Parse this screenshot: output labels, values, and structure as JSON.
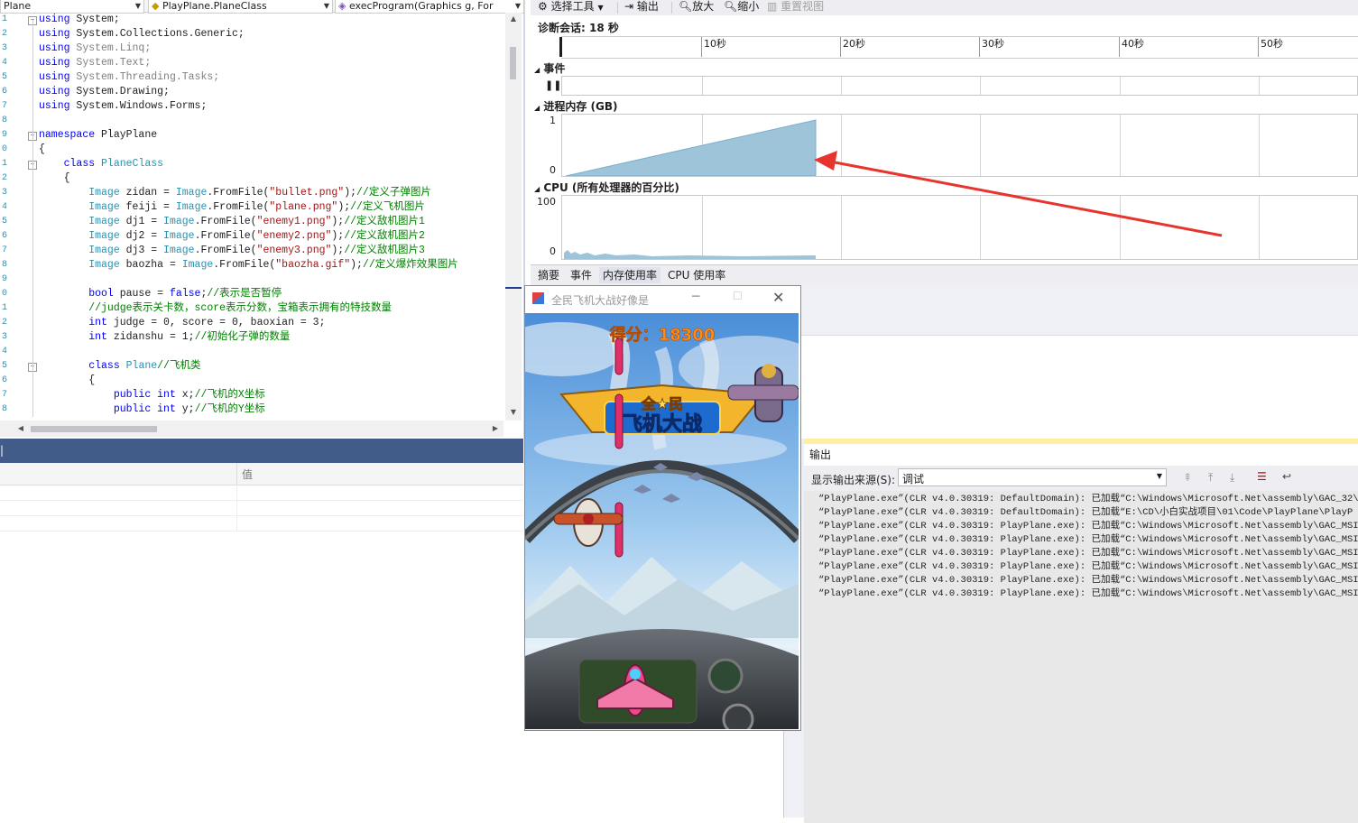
{
  "editor": {
    "nav": [
      "Plane",
      "PlayPlane.PlaneClass",
      "execProgram(Graphics g, For"
    ],
    "line_numbers": [
      "1",
      "2",
      "3",
      "4",
      "5",
      "6",
      "7",
      "8",
      "9",
      "0",
      "1",
      "2",
      "3",
      "4",
      "5",
      "6",
      "7",
      "8",
      "9",
      "0",
      "1",
      "2",
      "3",
      "4",
      "5",
      "6",
      "7",
      "8"
    ],
    "lines": [
      [
        [
          "kw",
          "using "
        ],
        [
          "",
          "System;"
        ]
      ],
      [
        [
          "kw",
          "using "
        ],
        [
          "",
          "System.Collections.Generic;"
        ]
      ],
      [
        [
          "kw",
          "using "
        ],
        [
          "gr",
          "System.Linq;"
        ]
      ],
      [
        [
          "kw",
          "using "
        ],
        [
          "gr",
          "System.Text;"
        ]
      ],
      [
        [
          "kw",
          "using "
        ],
        [
          "gr",
          "System.Threading.Tasks;"
        ]
      ],
      [
        [
          "kw",
          "using "
        ],
        [
          "",
          "System.Drawing;"
        ]
      ],
      [
        [
          "kw",
          "using "
        ],
        [
          "",
          "System.Windows.Forms;"
        ]
      ],
      [],
      [
        [
          "kw",
          "namespace "
        ],
        [
          "",
          "PlayPlane"
        ]
      ],
      [
        [
          "",
          "{"
        ]
      ],
      [
        [
          "",
          "    "
        ],
        [
          "kw",
          "class "
        ],
        [
          "ty",
          "PlaneClass"
        ]
      ],
      [
        [
          "",
          "    {"
        ]
      ],
      [
        [
          "",
          "        "
        ],
        [
          "ty",
          "Image"
        ],
        [
          "",
          " zidan = "
        ],
        [
          "ty",
          "Image"
        ],
        [
          "",
          ".FromFile("
        ],
        [
          "st",
          "\"bullet.png\""
        ],
        [
          "",
          ");"
        ],
        [
          "cm",
          "//定义子弹图片"
        ]
      ],
      [
        [
          "",
          "        "
        ],
        [
          "ty",
          "Image"
        ],
        [
          "",
          " feiji = "
        ],
        [
          "ty",
          "Image"
        ],
        [
          "",
          ".FromFile("
        ],
        [
          "st",
          "\"plane.png\""
        ],
        [
          "",
          ");"
        ],
        [
          "cm",
          "//定义飞机图片"
        ]
      ],
      [
        [
          "",
          "        "
        ],
        [
          "ty",
          "Image"
        ],
        [
          "",
          " dj1 = "
        ],
        [
          "ty",
          "Image"
        ],
        [
          "",
          ".FromFile("
        ],
        [
          "st",
          "\"enemy1.png\""
        ],
        [
          "",
          ");"
        ],
        [
          "cm",
          "//定义敌机图片1"
        ]
      ],
      [
        [
          "",
          "        "
        ],
        [
          "ty",
          "Image"
        ],
        [
          "",
          " dj2 = "
        ],
        [
          "ty",
          "Image"
        ],
        [
          "",
          ".FromFile("
        ],
        [
          "st",
          "\"enemy2.png\""
        ],
        [
          "",
          ");"
        ],
        [
          "cm",
          "//定义敌机图片2"
        ]
      ],
      [
        [
          "",
          "        "
        ],
        [
          "ty",
          "Image"
        ],
        [
          "",
          " dj3 = "
        ],
        [
          "ty",
          "Image"
        ],
        [
          "",
          ".FromFile("
        ],
        [
          "st",
          "\"enemy3.png\""
        ],
        [
          "",
          ");"
        ],
        [
          "cm",
          "//定义敌机图片3"
        ]
      ],
      [
        [
          "",
          "        "
        ],
        [
          "ty",
          "Image"
        ],
        [
          "",
          " baozha = "
        ],
        [
          "ty",
          "Image"
        ],
        [
          "",
          ".FromFile("
        ],
        [
          "st",
          "\"baozha.gif\""
        ],
        [
          "",
          ");"
        ],
        [
          "cm",
          "//定义爆炸效果图片"
        ]
      ],
      [],
      [
        [
          "",
          "        "
        ],
        [
          "kw",
          "bool"
        ],
        [
          "",
          " pause = "
        ],
        [
          "kw",
          "false"
        ],
        [
          "",
          ";"
        ],
        [
          "cm",
          "//表示是否暂停"
        ]
      ],
      [
        [
          "",
          "        "
        ],
        [
          "cm",
          "//judge表示关卡数，score表示分数，宝箱表示拥有的特技数量"
        ]
      ],
      [
        [
          "",
          "        "
        ],
        [
          "kw",
          "int"
        ],
        [
          "",
          " judge = 0, score = 0, baoxian = 3;"
        ]
      ],
      [
        [
          "",
          "        "
        ],
        [
          "kw",
          "int"
        ],
        [
          "",
          " zidanshu = 1;"
        ],
        [
          "cm",
          "//初始化子弹的数量"
        ]
      ],
      [],
      [
        [
          "",
          "        "
        ],
        [
          "kw",
          "class "
        ],
        [
          "ty",
          "Plane"
        ],
        [
          "cm",
          "//飞机类"
        ]
      ],
      [
        [
          "",
          "        {"
        ]
      ],
      [
        [
          "",
          "            "
        ],
        [
          "kw",
          "public int"
        ],
        [
          "",
          " x;"
        ],
        [
          "cm",
          "//飞机的X坐标"
        ]
      ],
      [
        [
          "",
          "            "
        ],
        [
          "kw",
          "public int"
        ],
        [
          "",
          " y;"
        ],
        [
          "cm",
          "//飞机的Y坐标"
        ]
      ]
    ]
  },
  "locals": {
    "col_value": "值",
    "left_char": "|"
  },
  "diagnostics": {
    "toolbar": {
      "select_tool": "选择工具",
      "output": "输出",
      "zoom_in": "放大",
      "zoom_out": "缩小",
      "reset_view": "重置视图"
    },
    "session_label": "诊断会话: 18 秒",
    "ticks": [
      "10秒",
      "20秒",
      "30秒",
      "40秒",
      "50秒"
    ],
    "events_label": "事件",
    "memory_label": "进程内存 (GB)",
    "memory_ymax": "1",
    "memory_ymin": "0",
    "cpu_label": "CPU (所有处理器的百分比)",
    "cpu_ymax": "100",
    "cpu_ymin": "0",
    "tabs": [
      "摘要",
      "事件",
      "内存使用率",
      "CPU 使用率"
    ],
    "active_tab": "内存使用率"
  },
  "game": {
    "title": "全民飞机大战好像是",
    "score": "得分：18300",
    "logo_top": "全★民",
    "logo_main": "飞机大战"
  },
  "output": {
    "title": "输出",
    "source_label": "显示输出来源(S):",
    "source_value": "调试",
    "lines": [
      "“PlayPlane.exe”(CLR v4.0.30319: DefaultDomain): 已加载“C:\\Windows\\Microsoft.Net\\assembly\\GAC_32\\m",
      "“PlayPlane.exe”(CLR v4.0.30319: DefaultDomain): 已加载“E:\\CD\\小白实战项目\\01\\Code\\PlayPlane\\PlayP",
      "“PlayPlane.exe”(CLR v4.0.30319: PlayPlane.exe): 已加载“C:\\Windows\\Microsoft.Net\\assembly\\GAC_MSIL",
      "“PlayPlane.exe”(CLR v4.0.30319: PlayPlane.exe): 已加载“C:\\Windows\\Microsoft.Net\\assembly\\GAC_MSIL",
      "“PlayPlane.exe”(CLR v4.0.30319: PlayPlane.exe): 已加载“C:\\Windows\\Microsoft.Net\\assembly\\GAC_MSIL",
      "“PlayPlane.exe”(CLR v4.0.30319: PlayPlane.exe): 已加载“C:\\Windows\\Microsoft.Net\\assembly\\GAC_MSIL",
      "“PlayPlane.exe”(CLR v4.0.30319: PlayPlane.exe): 已加载“C:\\Windows\\Microsoft.Net\\assembly\\GAC_MSIL",
      "“PlayPlane.exe”(CLR v4.0.30319: PlayPlane.exe): 已加载“C:\\Windows\\Microsoft.Net\\assembly\\GAC_MSIL"
    ]
  },
  "colors": {
    "keyword": "#0000ff",
    "type": "#2b91af",
    "string": "#a31515",
    "comment": "#008000",
    "memory_fill": "#9ec4da",
    "annotation_arrow": "#e8342e",
    "score_text": "#ff8c1a"
  }
}
